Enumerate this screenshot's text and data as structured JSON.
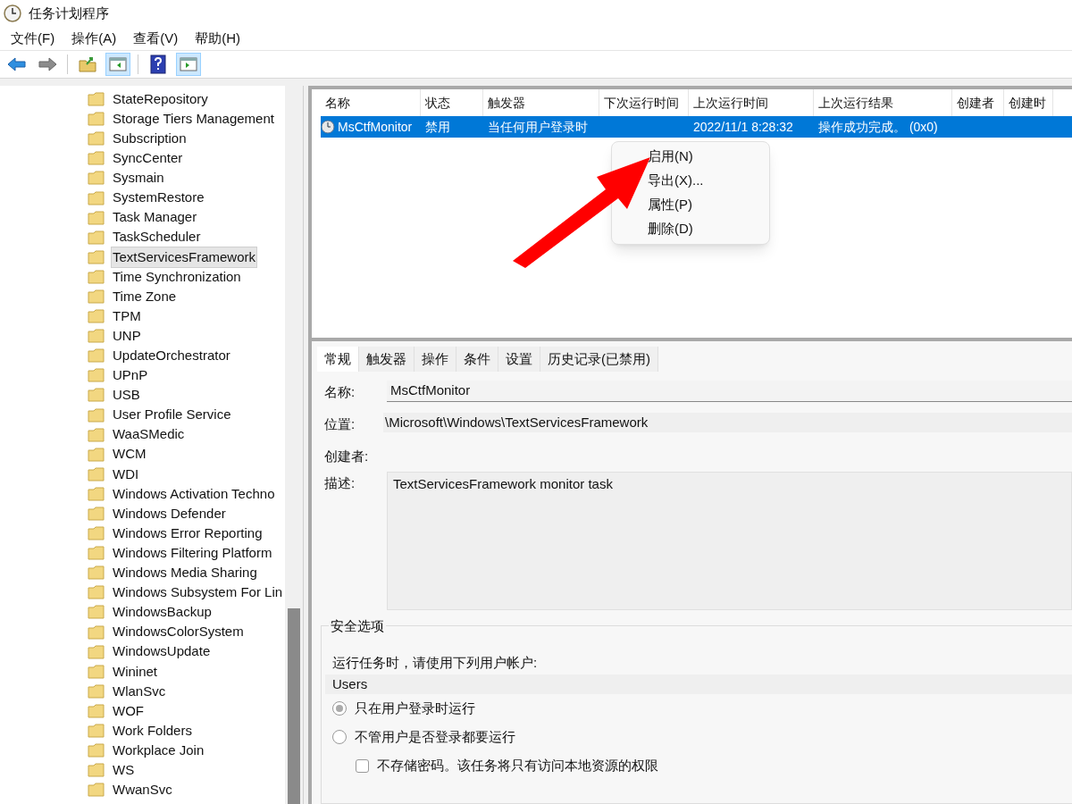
{
  "window": {
    "title": "任务计划程序"
  },
  "menu_bar": [
    "文件(F)",
    "操作(A)",
    "查看(V)",
    "帮助(H)"
  ],
  "toolbar": [
    {
      "kind": "back",
      "on": false
    },
    {
      "kind": "forward",
      "on": false
    },
    {
      "kind": "separator"
    },
    {
      "kind": "folder-up",
      "on": false
    },
    {
      "kind": "pane-left",
      "on": true
    },
    {
      "kind": "separator"
    },
    {
      "kind": "help",
      "on": false
    },
    {
      "kind": "pane-right",
      "on": true
    }
  ],
  "tree": {
    "items": [
      {
        "label": "StateRepository",
        "selected": false
      },
      {
        "label": "Storage Tiers Management",
        "selected": false
      },
      {
        "label": "Subscription",
        "selected": false
      },
      {
        "label": "SyncCenter",
        "selected": false
      },
      {
        "label": "Sysmain",
        "selected": false
      },
      {
        "label": "SystemRestore",
        "selected": false
      },
      {
        "label": "Task Manager",
        "selected": false
      },
      {
        "label": "TaskScheduler",
        "selected": false
      },
      {
        "label": "TextServicesFramework",
        "selected": true
      },
      {
        "label": "Time Synchronization",
        "selected": false
      },
      {
        "label": "Time Zone",
        "selected": false
      },
      {
        "label": "TPM",
        "selected": false
      },
      {
        "label": "UNP",
        "selected": false
      },
      {
        "label": "UpdateOrchestrator",
        "selected": false
      },
      {
        "label": "UPnP",
        "selected": false
      },
      {
        "label": "USB",
        "selected": false
      },
      {
        "label": "User Profile Service",
        "selected": false
      },
      {
        "label": "WaaSMedic",
        "selected": false
      },
      {
        "label": "WCM",
        "selected": false
      },
      {
        "label": "WDI",
        "selected": false
      },
      {
        "label": "Windows Activation Techno",
        "selected": false
      },
      {
        "label": "Windows Defender",
        "selected": false
      },
      {
        "label": "Windows Error Reporting",
        "selected": false
      },
      {
        "label": "Windows Filtering Platform",
        "selected": false
      },
      {
        "label": "Windows Media Sharing",
        "selected": false
      },
      {
        "label": "Windows Subsystem For Lin",
        "selected": false
      },
      {
        "label": "WindowsBackup",
        "selected": false
      },
      {
        "label": "WindowsColorSystem",
        "selected": false
      },
      {
        "label": "WindowsUpdate",
        "selected": false
      },
      {
        "label": "Wininet",
        "selected": false
      },
      {
        "label": "WlanSvc",
        "selected": false
      },
      {
        "label": "WOF",
        "selected": false
      },
      {
        "label": "Work Folders",
        "selected": false
      },
      {
        "label": "Workplace Join",
        "selected": false
      },
      {
        "label": "WS",
        "selected": false
      },
      {
        "label": "WwanSvc",
        "selected": false
      }
    ]
  },
  "task_table": {
    "columns": [
      "名称",
      "状态",
      "触发器",
      "下次运行时间",
      "上次运行时间",
      "上次运行结果",
      "创建者",
      "创建时"
    ],
    "rows": [
      {
        "selected": true,
        "cells": [
          "MsCtfMonitor",
          "禁用",
          "当任何用户登录时",
          "",
          "2022/11/1 8:28:32",
          "操作成功完成。 (0x0)",
          "",
          ""
        ]
      }
    ]
  },
  "context_menu": [
    "启用(N)",
    "导出(X)...",
    "属性(P)",
    "删除(D)"
  ],
  "detail_tabs": [
    {
      "label": "常规",
      "selected": true
    },
    {
      "label": "触发器",
      "selected": false
    },
    {
      "label": "操作",
      "selected": false
    },
    {
      "label": "条件",
      "selected": false
    },
    {
      "label": "设置",
      "selected": false
    },
    {
      "label": "历史记录(已禁用)",
      "selected": false
    }
  ],
  "general": {
    "name_label": "名称:",
    "name": "MsCtfMonitor",
    "location_label": "位置:",
    "location": "\\Microsoft\\Windows\\TextServicesFramework",
    "author_label": "创建者:",
    "description_label": "描述:",
    "description": "TextServicesFramework monitor task"
  },
  "security": {
    "title": "安全选项",
    "account_prompt": "运行任务时，请使用下列用户帐户:",
    "account": "Users",
    "options": [
      {
        "kind": "radio",
        "label": "只在用户登录时运行",
        "selected": true
      },
      {
        "kind": "radio",
        "label": "不管用户是否登录都要运行",
        "selected": false
      },
      {
        "kind": "checkbox",
        "label": "不存储密码。该任务将只有访问本地资源的权限",
        "checked": false
      }
    ]
  }
}
